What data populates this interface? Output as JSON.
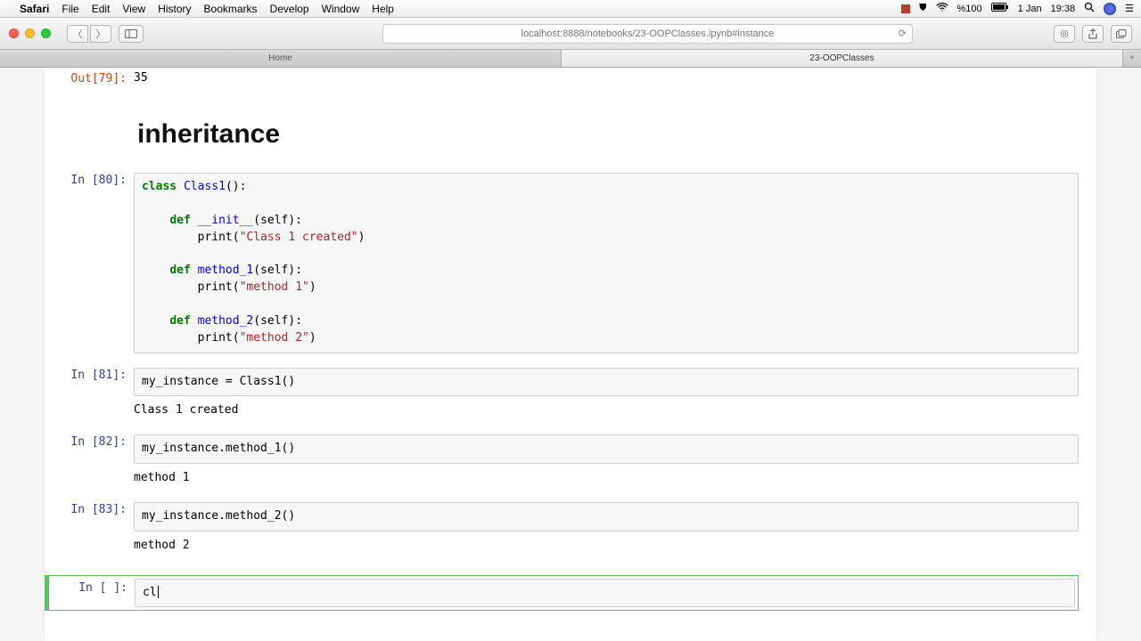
{
  "menubar": {
    "app": "Safari",
    "items": [
      "File",
      "Edit",
      "View",
      "History",
      "Bookmarks",
      "Develop",
      "Window",
      "Help"
    ],
    "battery": "%100",
    "date": "1 Jan",
    "time": "19:38"
  },
  "toolbar": {
    "url": "localhost:8888/notebooks/23-OOPClasses.ipynb#instance"
  },
  "tabs": {
    "home": "Home",
    "active": "23-OOPClasses"
  },
  "nb": {
    "out79_prompt": "Out[79]:",
    "out79_val": "35",
    "heading": "inheritance",
    "in80_prompt": "In [80]:",
    "code80": {
      "l1_kw": "class",
      "l1_cls": " Class1",
      "l1_rest": "():",
      "l3_def": "def",
      "l3_fn": " __init__",
      "l3_rest": "(self):",
      "l4_pre": "        print(",
      "l4_str": "\"Class 1 created\"",
      "l4_post": ")",
      "l6_def": "def",
      "l6_fn": " method_1",
      "l6_rest": "(self):",
      "l7_pre": "        print(",
      "l7_str": "\"method 1\"",
      "l7_post": ")",
      "l9_def": "def",
      "l9_fn": " method_2",
      "l9_rest": "(self):",
      "l10_pre": "        print(",
      "l10_str": "\"method 2\"",
      "l10_post": ")"
    },
    "in81_prompt": "In [81]:",
    "code81": "my_instance = Class1()",
    "out81": "Class 1 created",
    "in82_prompt": "In [82]:",
    "code82": "my_instance.method_1()",
    "out82": "method 1",
    "in83_prompt": "In [83]:",
    "code83": "my_instance.method_2()",
    "out83": "method 2",
    "in_blank_prompt": "In [ ]:",
    "active_text": "cl"
  }
}
